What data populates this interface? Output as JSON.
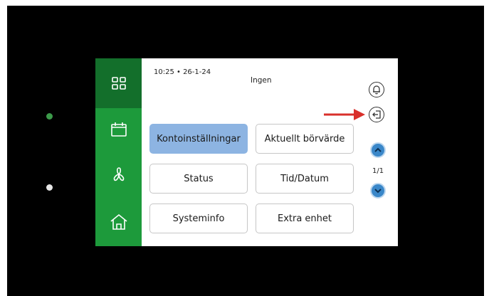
{
  "header": {
    "timestamp": "10:25 • 26-1-24",
    "mode": "Ingen"
  },
  "sidebar": {
    "items": [
      {
        "icon": "grid-icon",
        "active": true
      },
      {
        "icon": "calendar-icon",
        "active": false
      },
      {
        "icon": "fan-icon",
        "active": false
      },
      {
        "icon": "home-icon",
        "active": false
      }
    ]
  },
  "menu": {
    "buttons": [
      {
        "label": "Kontoinställningar",
        "selected": true
      },
      {
        "label": "Aktuellt börvärde",
        "selected": false
      },
      {
        "label": "Status",
        "selected": false
      },
      {
        "label": "Tid/Datum",
        "selected": false
      },
      {
        "label": "Systeminfo",
        "selected": false
      },
      {
        "label": "Extra enhet",
        "selected": false
      }
    ]
  },
  "right_panel": {
    "bell_icon": "bell-icon",
    "logout_icon": "logout-icon",
    "page_indicator": "1/1",
    "up_icon": "chevron-up-icon",
    "down_icon": "chevron-down-icon"
  },
  "colors": {
    "sidebar": "#1d9a3b",
    "sidebar_active": "#136f2b",
    "selected_button": "#8db4e2",
    "nav_button": "#3a87c9",
    "annotation_arrow": "#d9302b",
    "status_led": "#3c9a4a"
  }
}
